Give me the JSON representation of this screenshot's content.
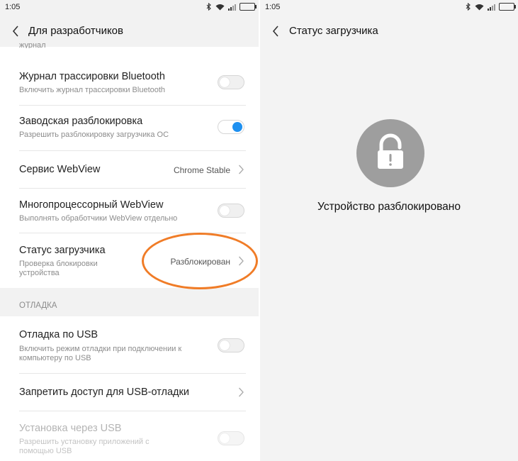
{
  "status_bar": {
    "time_left": "1:05",
    "time_right": "1:05"
  },
  "left": {
    "title": "Для разработчиков",
    "partial_label": "журнал",
    "items": [
      {
        "title": "Журнал трассировки Bluetooth",
        "subtitle": "Включить журнал трассировки Bluetooth",
        "toggle": "off"
      },
      {
        "title": "Заводская разблокировка",
        "subtitle": "Разрешить разблокировку загрузчика ОС",
        "toggle": "on"
      },
      {
        "title": "Сервис WebView",
        "value": "Chrome Stable"
      },
      {
        "title": "Многопроцессорный WebView",
        "subtitle": "Выполнять обработчики WebView отдельно",
        "toggle": "off"
      },
      {
        "title": "Статус загрузчика",
        "subtitle_line1": "Проверка блокировки",
        "subtitle_line2": "устройства",
        "value": "Разблокирован"
      }
    ],
    "section_header": "ОТЛАДКА",
    "debug_items": [
      {
        "title": "Отладка по USB",
        "subtitle_line1": "Включить режим отладки при подключении к",
        "subtitle_line2": "компьютеру по USB",
        "toggle": "off"
      },
      {
        "title": "Запретить доступ для USB-отладки"
      },
      {
        "title": "Установка через USB",
        "subtitle_line1": "Разрешить установку приложений с",
        "subtitle_line2": "помощью USB",
        "toggle": "off",
        "disabled": true
      }
    ]
  },
  "right": {
    "title": "Статус загрузчика",
    "message": "Устройство разблокировано"
  },
  "colors": {
    "accent": "#1e90f0",
    "highlight": "#f07c27",
    "lock_circle": "#9e9e9e"
  }
}
